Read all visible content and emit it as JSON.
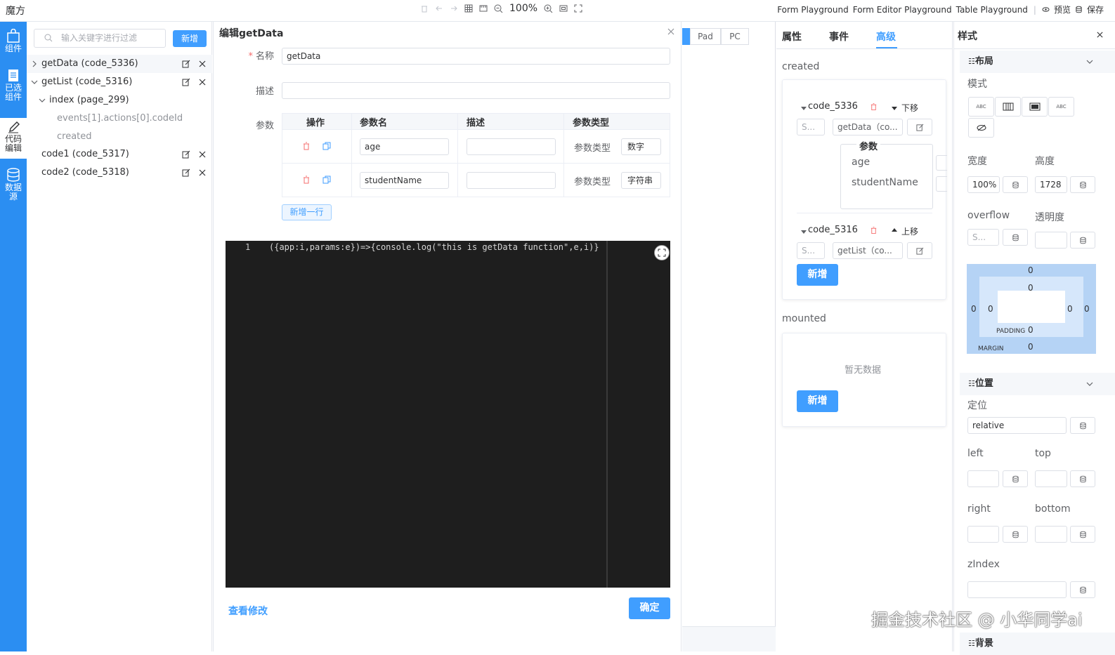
{
  "topbar": {
    "brand": "魔方",
    "zoom": "100%",
    "links": [
      "Form Playground",
      "Form Editor Playground",
      "Table Playground"
    ],
    "preview": "预览",
    "save": "保存"
  },
  "rail": [
    {
      "label": "组件"
    },
    {
      "label": "已选组件"
    },
    {
      "label": "代码编辑"
    },
    {
      "label": "数据源"
    }
  ],
  "tree": {
    "search_placeholder": "输入关键字进行过滤",
    "add": "新增",
    "nodes": [
      {
        "label": "getData (code_5336)"
      },
      {
        "label": "getList (code_5316)"
      },
      {
        "label": "index (page_299)"
      },
      {
        "label": "events[1].actions[0].codeId"
      },
      {
        "label": "created"
      },
      {
        "label": "code1 (code_5317)"
      },
      {
        "label": "code2 (code_5318)"
      }
    ]
  },
  "dialog": {
    "title": "编辑getData",
    "name_label": "名称",
    "name_value": "getData",
    "desc_label": "描述",
    "params_label": "参数",
    "columns": [
      "操作",
      "参数名",
      "描述",
      "参数类型"
    ],
    "rows": [
      {
        "name": "age",
        "type_label": "参数类型",
        "type": "数字"
      },
      {
        "name": "studentName",
        "type_label": "参数类型",
        "type": "字符串"
      }
    ],
    "add_row": "新增一行",
    "code_line_no": "1",
    "code": "({app:i,params:e})=>{console.log(\"this is getData function\",e,i)}",
    "view_diff": "查看修改",
    "ok": "确定"
  },
  "canvas": {
    "device_tabs": [
      "Pad",
      "PC"
    ]
  },
  "props": {
    "tabs": [
      "属性",
      "事件",
      "高级"
    ],
    "active_tab": "高级",
    "created_label": "created",
    "events": [
      {
        "code": "code_5336",
        "move": "下移",
        "select_ph": "S...",
        "func": "getData（co...",
        "params_title": "参数",
        "params": [
          "age",
          "studentName"
        ]
      },
      {
        "code": "code_5316",
        "move": "上移",
        "select_ph": "S...",
        "func": "getList（co..."
      }
    ],
    "add": "新增",
    "mounted_label": "mounted",
    "empty": "暂无数据",
    "add2": "新增"
  },
  "style": {
    "title": "样式",
    "layout_group": "布局",
    "mode_label": "模式",
    "mode_buttons": [
      "ABC",
      "",
      "",
      "ABC"
    ],
    "width_label": "宽度",
    "width_value": "100%",
    "height_label": "高度",
    "height_value": "1728",
    "overflow_label": "overflow",
    "overflow_ph": "S...",
    "opacity_label": "透明度",
    "box": {
      "margin_top": "0",
      "padding_top": "0",
      "margin_left": "0",
      "padding_left": "0",
      "padding_right": "0",
      "margin_right": "0",
      "padding_bottom": "0",
      "margin_bottom": "0",
      "padding_label": "PADDING",
      "margin_label": "MARGIN"
    },
    "position_group": "位置",
    "position_label": "定位",
    "position_value": "relative",
    "left_label": "left",
    "top_label": "top",
    "right_label": "right",
    "bottom_label": "bottom",
    "zindex_label": "zIndex",
    "bg_group": "背景"
  },
  "watermark": "掘金技术社区 @ 小华同学ai",
  "colors": {
    "primary": "#409eff",
    "rail": "#2b8ef2",
    "danger": "#f56c6c"
  }
}
